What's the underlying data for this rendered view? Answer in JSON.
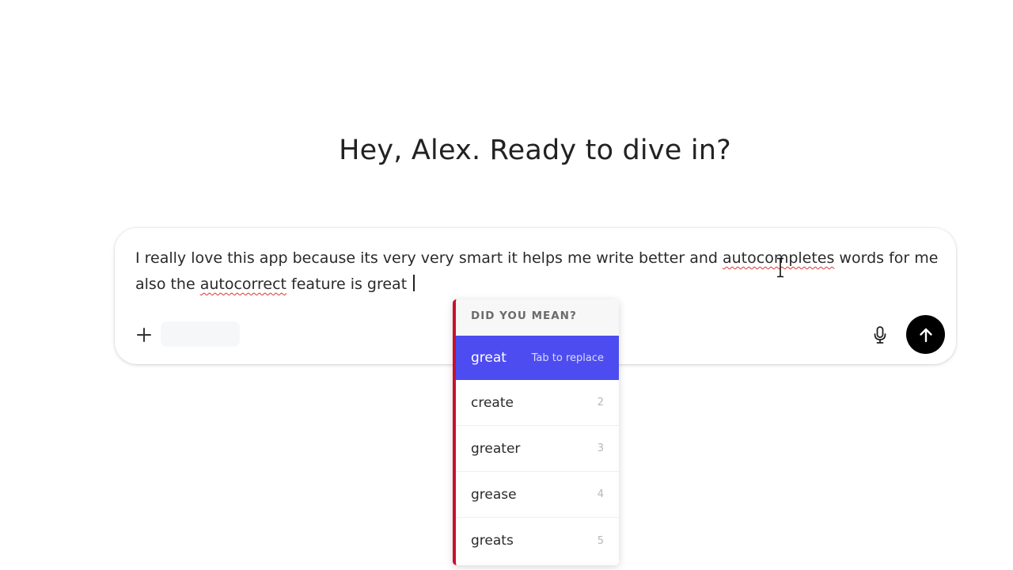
{
  "greeting": "Hey, Alex. Ready to dive in?",
  "composer": {
    "segments": [
      {
        "text": "I really love this app because its very very smart it helps me write better and ",
        "misspelled": false
      },
      {
        "text": "autocompletes",
        "misspelled": true
      },
      {
        "text": " words for me also the ",
        "misspelled": false
      },
      {
        "text": "autocorrect",
        "misspelled": true
      },
      {
        "text": " feature is great ",
        "misspelled": false
      }
    ],
    "plus_icon": "plus-icon",
    "mic_icon": "microphone-icon",
    "send_icon": "arrow-up-icon"
  },
  "suggestions": {
    "header": "DID YOU MEAN?",
    "active_index": 0,
    "accent_color": "#4d4cf0",
    "border_color": "#c8102e",
    "items": [
      {
        "word": "great",
        "hint": "Tab to replace"
      },
      {
        "word": "create",
        "hint": "2"
      },
      {
        "word": "greater",
        "hint": "3"
      },
      {
        "word": "grease",
        "hint": "4"
      },
      {
        "word": "greats",
        "hint": "5"
      }
    ]
  }
}
